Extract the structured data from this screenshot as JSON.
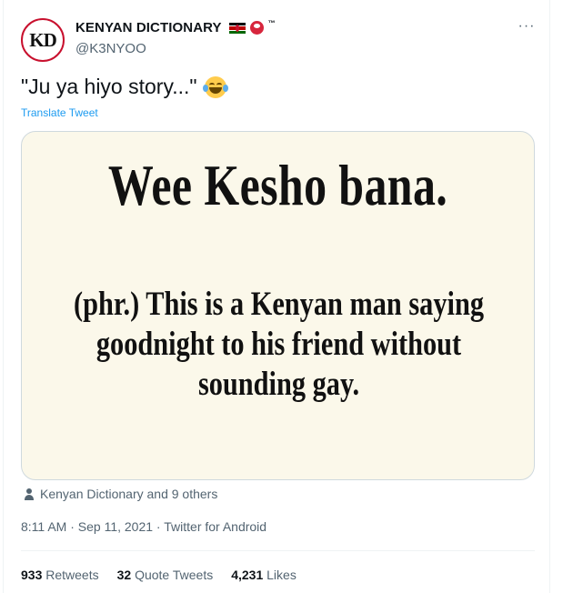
{
  "author": {
    "avatar_text": "KD",
    "display_name": "KENYAN DICTIONARY",
    "tm_symbol": "™",
    "handle": "@K3NYOO",
    "flag_icon": "kenya-flag-icon",
    "helmet_icon": "red-helmet-icon"
  },
  "more_menu": {
    "label": "···"
  },
  "tweet": {
    "text": "\"Ju ya hiyo story...\"",
    "emoji": "face-with-tears-of-joy-icon",
    "translate_label": "Translate Tweet"
  },
  "media": {
    "headline": "Wee Kesho bana.",
    "definition_line1": "(phr.) This is a Kenyan man saying",
    "definition_line2": "goodnight to his friend without",
    "definition_line3": "sounding gay.",
    "background_color": "#fbf8ea"
  },
  "liked_by": {
    "text": "Kenyan Dictionary and 9 others"
  },
  "meta": {
    "time": "8:11 AM",
    "separator": " · ",
    "date": "Sep 11, 2021",
    "source": "Twitter for Android"
  },
  "stats": {
    "retweets_count": "933",
    "retweets_label": " Retweets",
    "quotes_count": "32",
    "quotes_label": " Quote Tweets",
    "likes_count": "4,231",
    "likes_label": " Likes"
  },
  "colors": {
    "link": "#1d9bf0",
    "secondary_text": "#536471",
    "primary_text": "#0f1419",
    "avatar_ring": "#c8102e"
  }
}
